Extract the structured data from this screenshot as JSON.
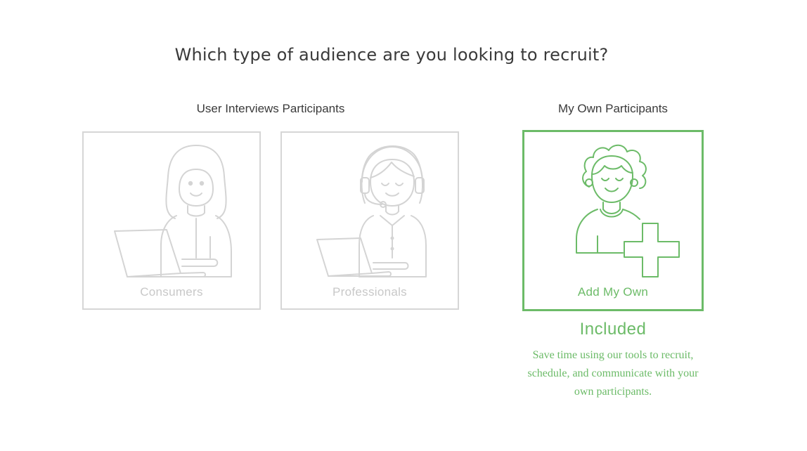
{
  "page": {
    "title": "Which type of audience are you looking to recruit?"
  },
  "groups": {
    "user_interviews": {
      "heading": "User Interviews Participants",
      "cards": [
        {
          "label": "Consumers",
          "icon": "consumer-with-laptop-icon",
          "state": "disabled"
        },
        {
          "label": "Professionals",
          "icon": "professional-with-headset-icon",
          "state": "disabled"
        }
      ]
    },
    "own": {
      "heading": "My Own Participants",
      "card": {
        "label": "Add My Own",
        "icon": "person-add-icon",
        "state": "selected"
      },
      "price_label": "Included",
      "description": "Save time using our tools to recruit, schedule, and communicate with your own participants."
    }
  },
  "colors": {
    "accent": "#6cbb68",
    "disabled": "#d6d6d6",
    "text": "#3a3a3a"
  }
}
